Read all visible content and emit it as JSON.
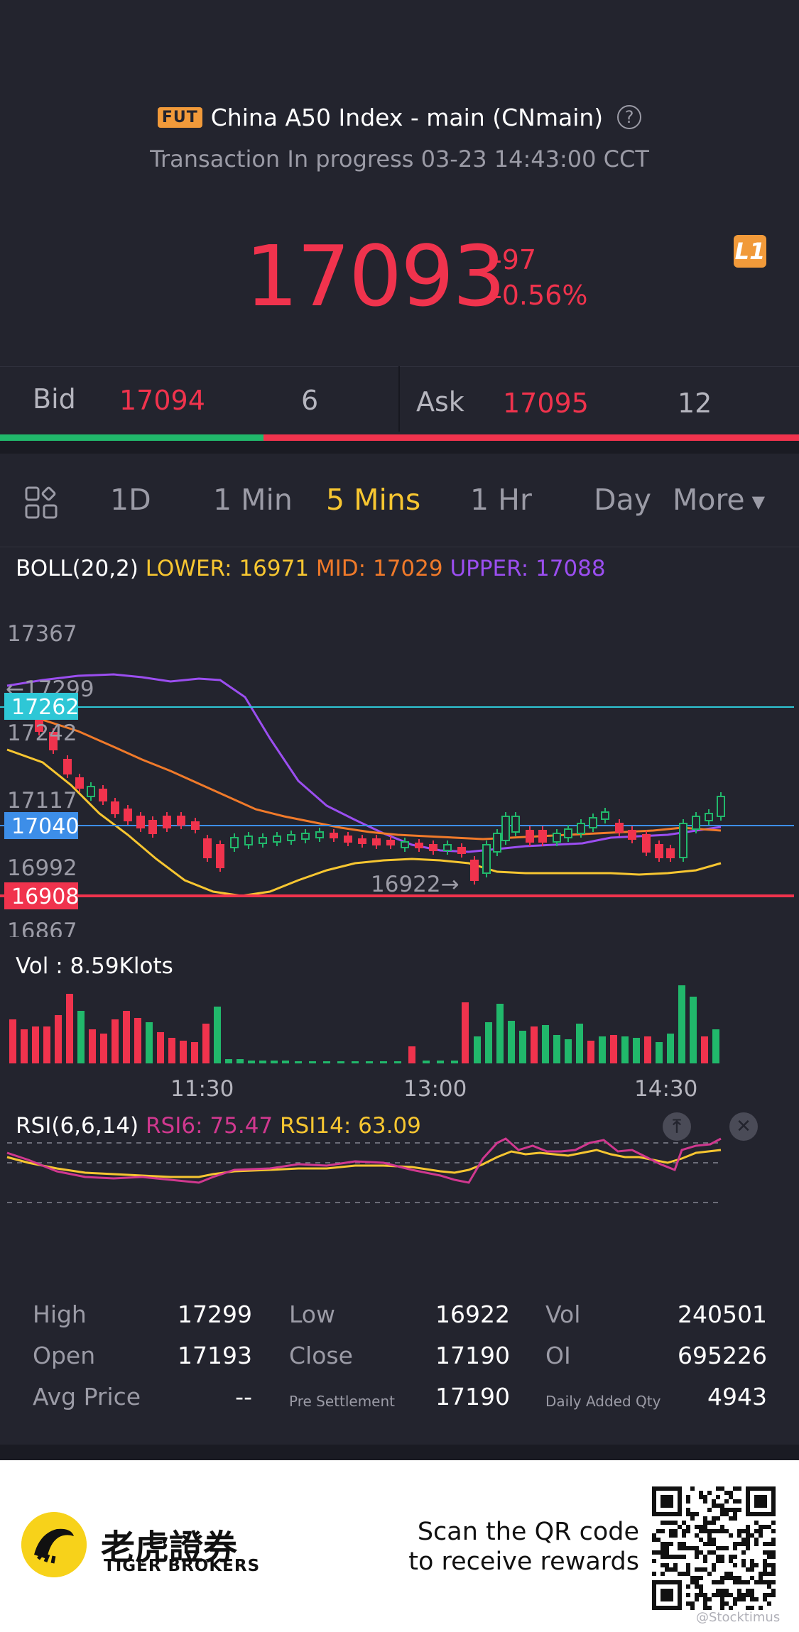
{
  "header": {
    "badge": "FUT",
    "title": "China A50 Index - main (CNmain)",
    "status": "Transaction In progress 03-23 14:43:00 CCT",
    "last_price": "17093",
    "change_abs": "-97",
    "change_pct": "-0.56%",
    "level_badge": "L1"
  },
  "quote": {
    "bid_label": "Bid",
    "bid_price": "17094",
    "bid_qty": "6",
    "ask_label": "Ask",
    "ask_price": "17095",
    "ask_qty": "12",
    "bid_ratio": 0.33
  },
  "tabs": {
    "items": [
      "1D",
      "1 Min",
      "5 Mins",
      "1 Hr",
      "Day",
      "More"
    ],
    "active": "5 Mins"
  },
  "boll": {
    "name": "BOLL(20,2)",
    "lower": "LOWER: 16971",
    "mid": "MID: 17029",
    "upper": "UPPER: 17088"
  },
  "price_chart": {
    "axis_labels": [
      "17367",
      "17242",
      "17117",
      "16992",
      "16867"
    ],
    "ref_lines": {
      "cyan": "17262",
      "blue": "17040",
      "red": "16908"
    },
    "high_marker": "←17299",
    "low_marker": "16922→"
  },
  "volume": {
    "label": "Vol  : 8.59Klots",
    "time_labels": [
      "11:30",
      "13:00",
      "14:30"
    ]
  },
  "rsi": {
    "name": "RSI(6,6,14)",
    "rsi6": "RSI6: 75.47",
    "rsi14": "RSI14: 63.09"
  },
  "stats": {
    "high_label": "High",
    "high": "17299",
    "low_label": "Low",
    "low": "16922",
    "vol_label": "Vol",
    "vol": "240501",
    "open_label": "Open",
    "open": "17193",
    "close_label": "Close",
    "close": "17190",
    "oi_label": "OI",
    "oi": "695226",
    "avg_label": "Avg Price",
    "avg": "--",
    "presettle_label": "Pre Settlement",
    "presettle": "17190",
    "daily_added_label": "Daily Added Qty",
    "daily_added": "4943"
  },
  "footer": {
    "brand_cn": "老虎證券",
    "brand_en": "TIGER BROKERS",
    "scan_line1": "Scan the QR code",
    "scan_line2": "to receive rewards",
    "watermark": "@Stocktimus"
  },
  "colors": {
    "up": "#21b86b",
    "down": "#f0334d",
    "accent": "#f7c631",
    "boll_lower": "#f7c631",
    "boll_mid": "#f07a2a",
    "boll_upper": "#9b4ef0",
    "ref_cyan": "#2ec7d6",
    "ref_blue": "#3d8ee8",
    "ref_red": "#f0334d",
    "rsi6": "#d0388f"
  },
  "icons": [
    "fut-badge",
    "help-icon",
    "l1-badge",
    "grid-icon",
    "dropdown-icon",
    "pin-top-icon",
    "close-icon",
    "tiger-logo",
    "qr-code"
  ]
}
